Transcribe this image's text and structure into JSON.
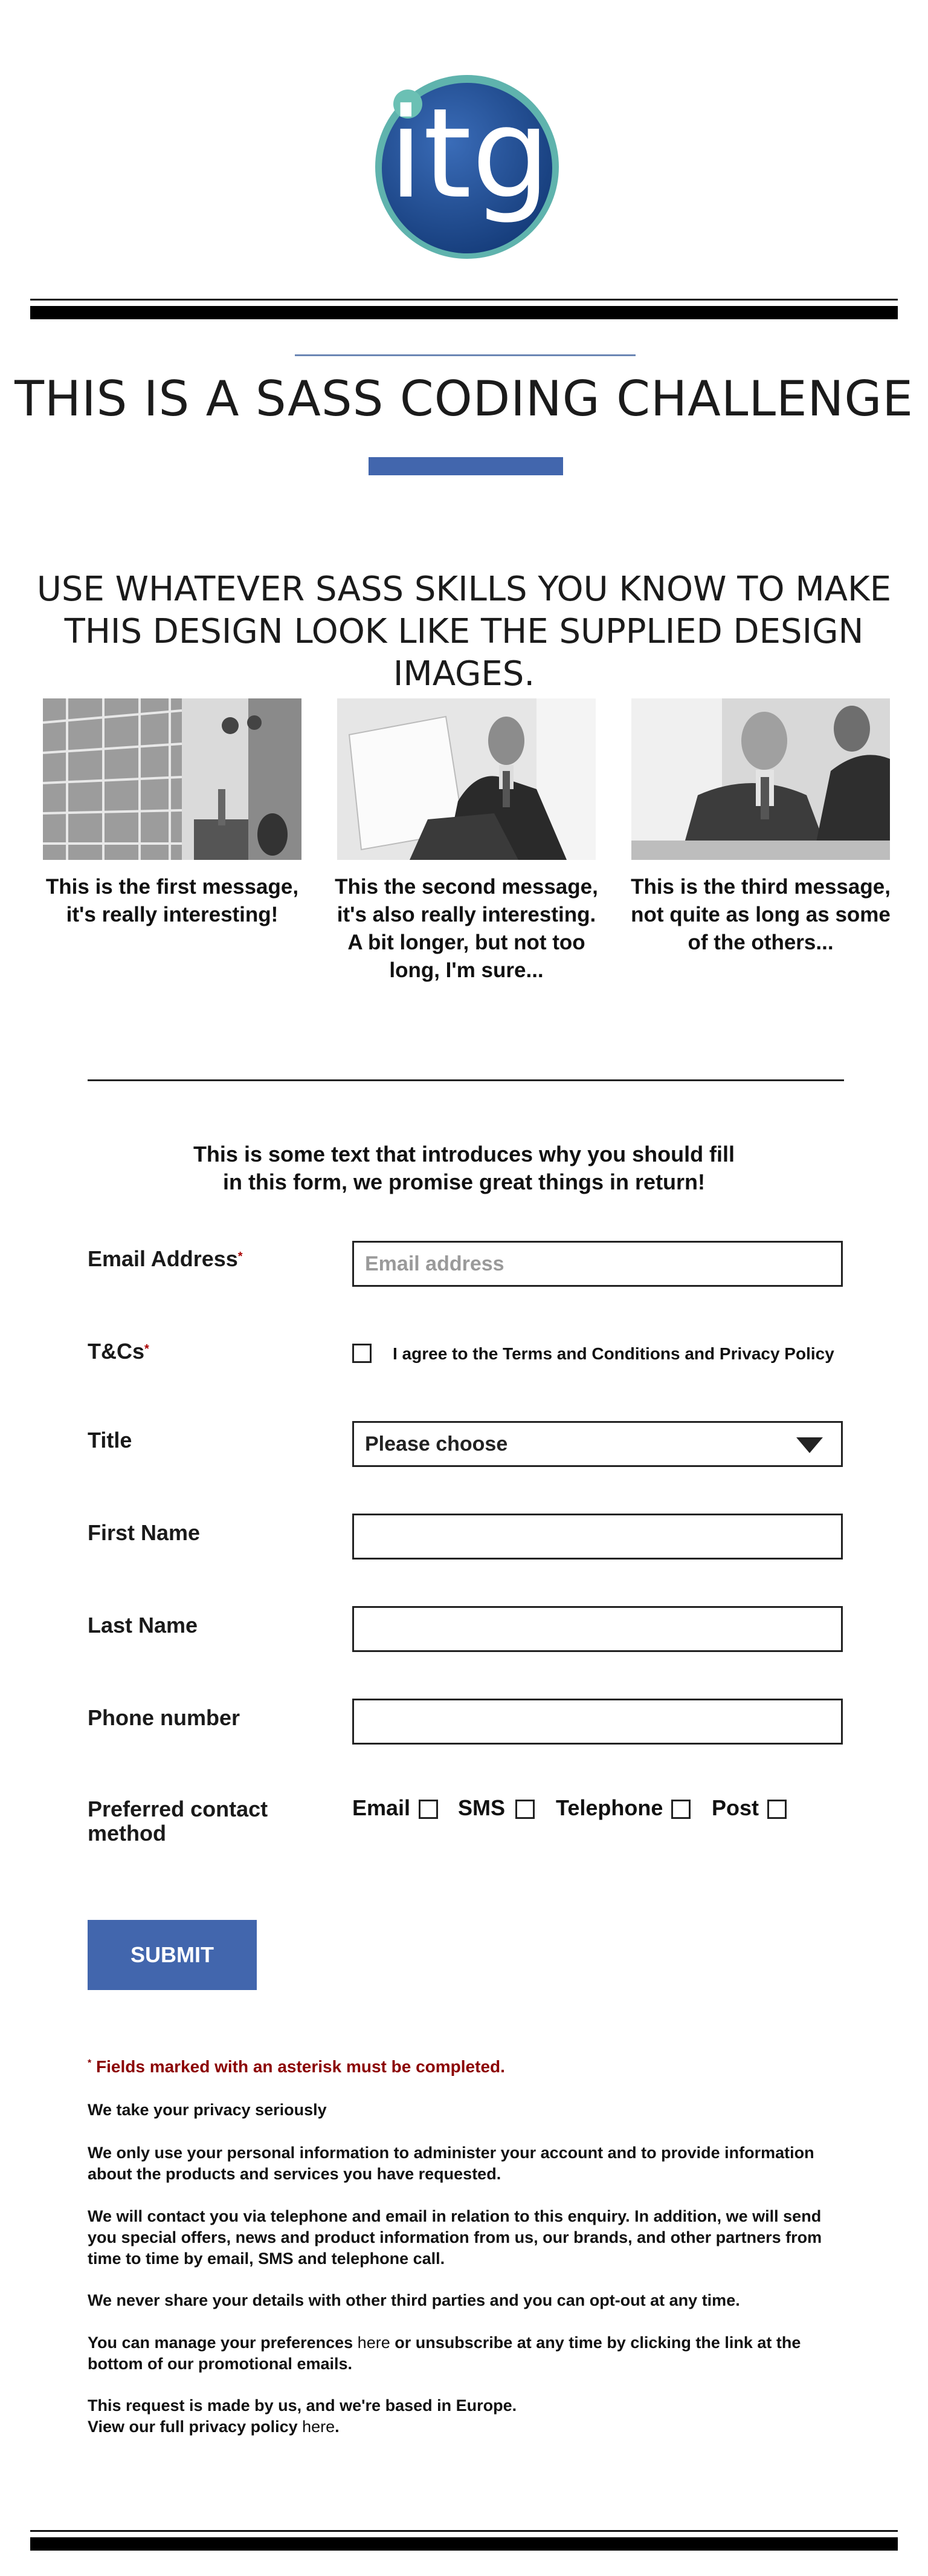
{
  "logo": {
    "text": "itg",
    "colors": {
      "ring": "#5fb3ad",
      "fill": "#1f4e94",
      "dot": "#6bc0b4"
    }
  },
  "header": {
    "title": "THIS IS A SASS CODING CHALLENGE",
    "subtitle": "USE WHATEVER SASS SKILLS YOU KNOW TO MAKE THIS DESIGN LOOK LIKE THE SUPPLIED DESIGN IMAGES."
  },
  "cards": [
    {
      "image": "library-photo",
      "text": "This is the first message, it's really interesting!"
    },
    {
      "image": "businessman-reading-photo",
      "text": "This the second message, it's also really interesting. A bit longer, but not too long, I'm sure..."
    },
    {
      "image": "business-meeting-photo",
      "text": "This is the third message, not quite as long as some of the others..."
    }
  ],
  "form": {
    "intro": "This is some text that introduces why you should fill in this form, we promise great things in return!",
    "email": {
      "label": "Email Address",
      "required": "*",
      "placeholder": "Email address"
    },
    "tc": {
      "label": "T&Cs",
      "required": "*",
      "text_prefix": "I agree to the ",
      "terms_link": "Terms and Conditions",
      "and": " and ",
      "privacy_link": "Privacy Policy"
    },
    "title": {
      "label": "Title",
      "placeholder": "Please choose"
    },
    "first_name": {
      "label": "First Name",
      "value": ""
    },
    "last_name": {
      "label": "Last Name",
      "value": ""
    },
    "phone": {
      "label": "Phone number",
      "value": ""
    },
    "contact": {
      "label": "Preferred contact method",
      "options": [
        "Email",
        "SMS",
        "Telephone",
        "Post"
      ]
    },
    "submit_label": "Submit"
  },
  "footer": {
    "required_marker": "*",
    "required_note": " Fields marked with an asterisk must be completed.",
    "privacy_heading": "We take your privacy seriously",
    "p1": "We only use your personal information to administer your account and to provide information about the products and services you have requested.",
    "p2": "We will contact you via telephone and email in relation to this enquiry. In addition, we will send you special offers, news and product information from us, our brands, and other partners from time to time by email, SMS and telephone call.",
    "p3": "We never share your details with other third parties and you can opt-out at any time.",
    "p4_prefix": "You can manage your preferences ",
    "p4_link": "here",
    "p4_suffix": " or unsubscribe at any time by clicking the link at the bottom of our promotional emails.",
    "p5_line1": "This request is made by us, and we're based in Europe.",
    "p5_prefix": "View our full privacy policy ",
    "p5_link": "here",
    "p5_suffix": "."
  },
  "colors": {
    "accent": "#4266ad",
    "error": "#8b0000"
  }
}
